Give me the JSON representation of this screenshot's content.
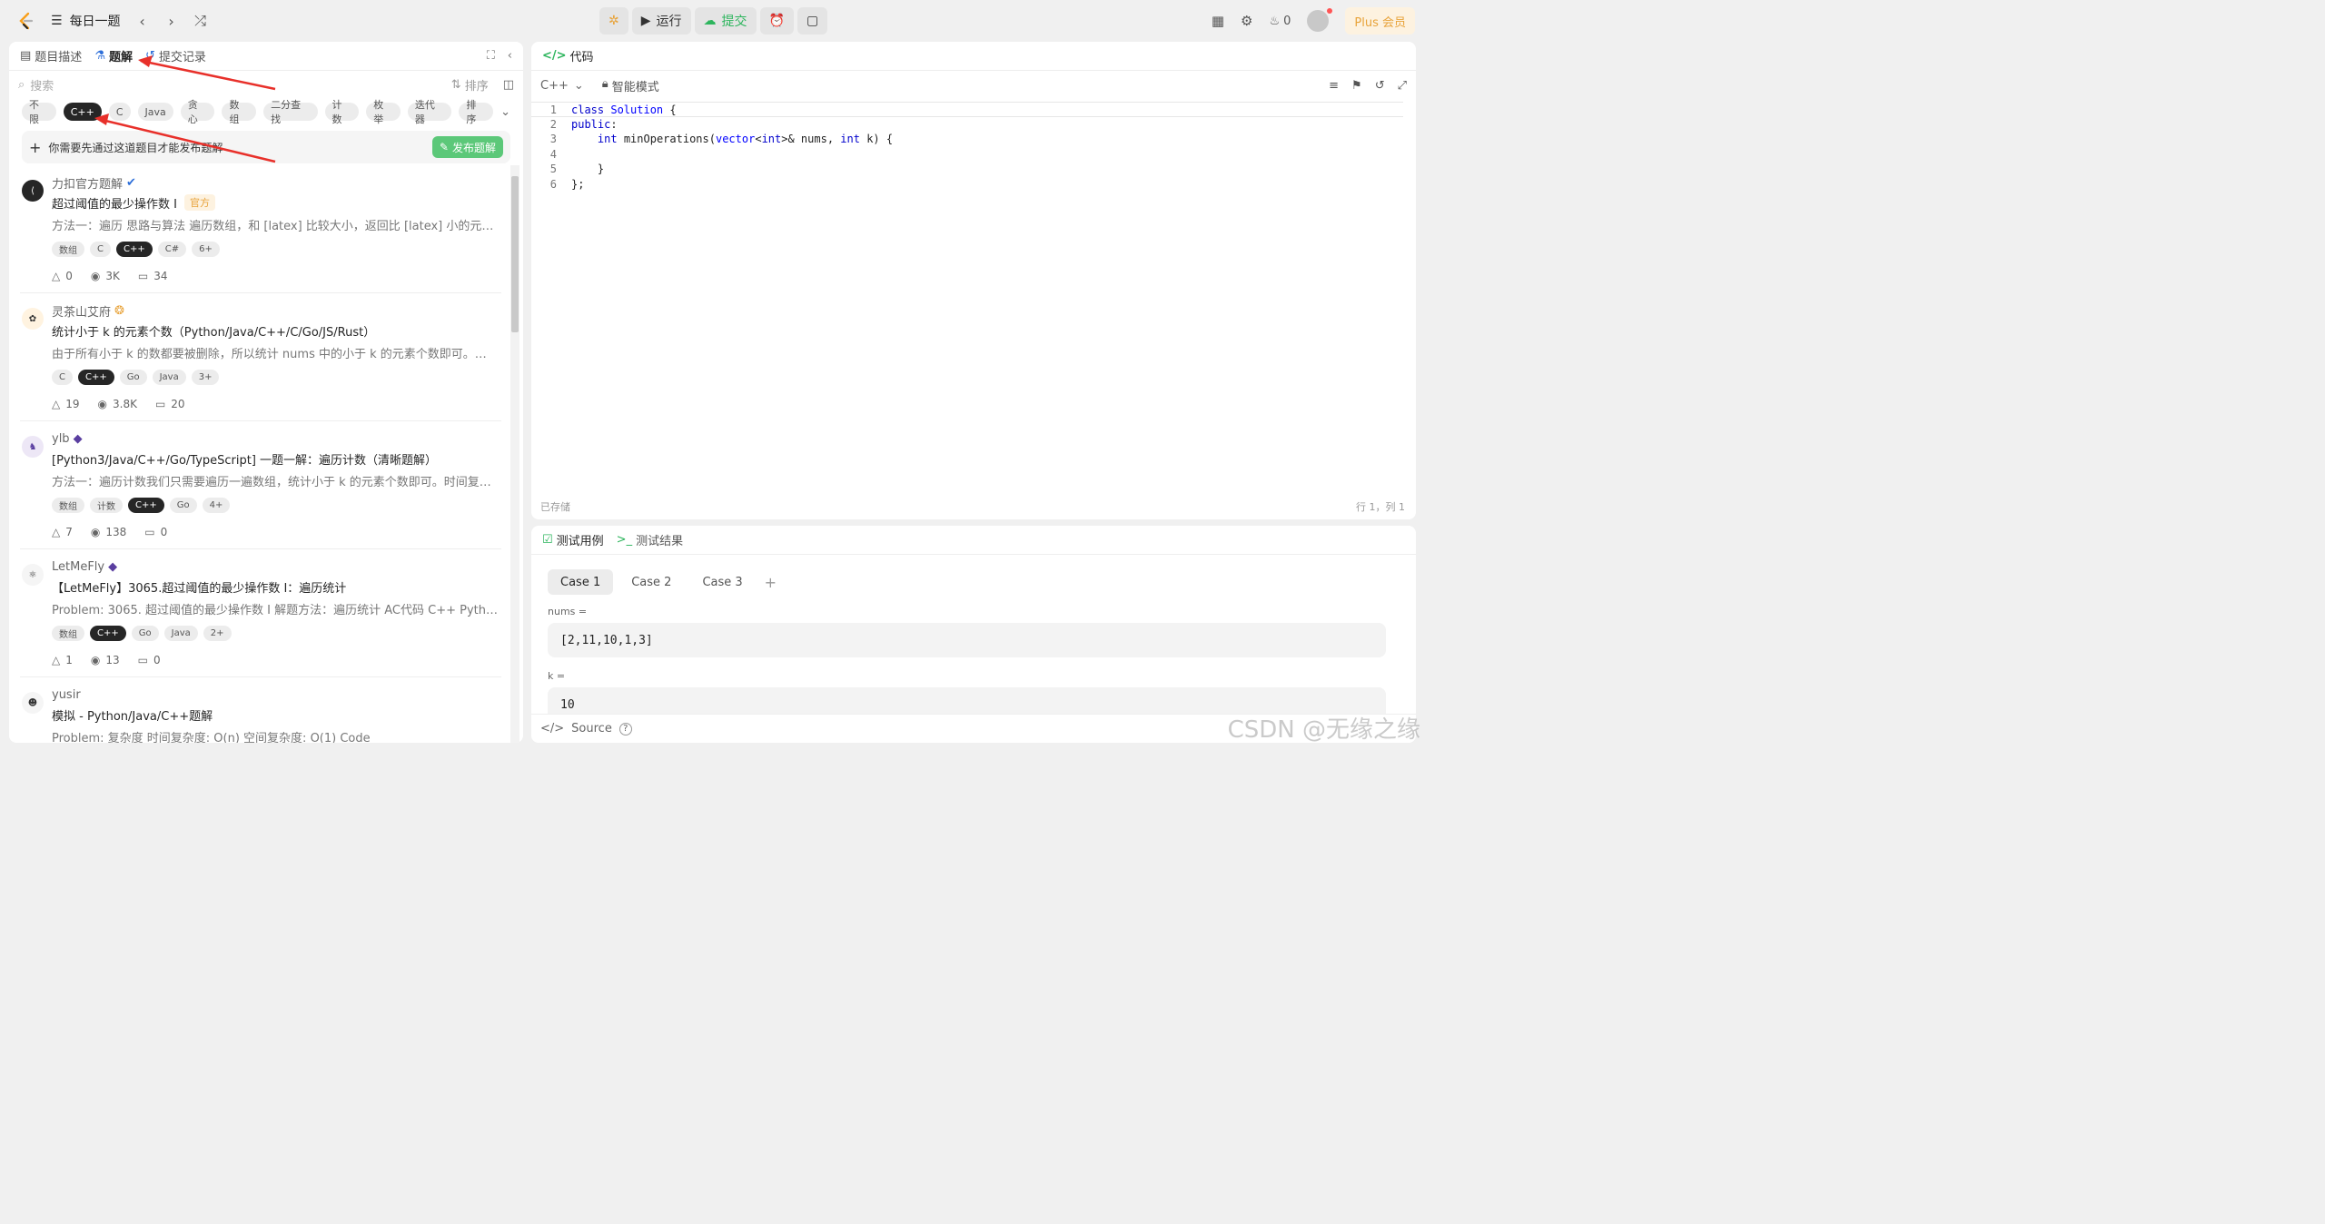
{
  "topbar": {
    "daily_label": "每日一题",
    "run_label": "运行",
    "submit_label": "提交",
    "fire_count": "0",
    "plus_label": "Plus 会员"
  },
  "left": {
    "tabs": [
      "题目描述",
      "题解",
      "提交记录"
    ],
    "search_placeholder": "搜索",
    "sort_label": "排序",
    "filter_tags": [
      "不限",
      "C++",
      "C",
      "Java",
      "贪心",
      "数组",
      "二分查找",
      "计数",
      "枚举",
      "迭代器",
      "排序"
    ],
    "notice": "你需要先通过这道题目才能发布题解",
    "publish_label": "发布题解",
    "solutions": [
      {
        "author": "力扣官方题解",
        "title": "超过阈值的最少操作数 I",
        "badge": "官方",
        "summary": "方法一：遍历 思路与算法 遍历数组，和 [latex] 比较大小，返回比 [latex] 小的元素的...",
        "tags": [
          "数组",
          "C",
          "C++",
          "C#",
          "6+"
        ],
        "likes": "0",
        "views": "3K",
        "comments": "34"
      },
      {
        "author": "灵茶山艾府",
        "title": "统计小于 k 的元素个数（Python/Java/C++/C/Go/JS/Rust）",
        "summary": "由于所有小于 k 的数都要被删除，所以统计 nums 中的小于 k 的元素个数即可。复杂...",
        "tags": [
          "C",
          "C++",
          "Go",
          "Java",
          "3+"
        ],
        "likes": "19",
        "views": "3.8K",
        "comments": "20"
      },
      {
        "author": "ylb",
        "title": "[Python3/Java/C++/Go/TypeScript] 一题一解：遍历计数（清晰题解）",
        "summary": "方法一：遍历计数我们只需要遍历一遍数组，统计小于 k 的元素个数即可。时间复杂...",
        "tags": [
          "数组",
          "计数",
          "C++",
          "Go",
          "4+"
        ],
        "likes": "7",
        "views": "138",
        "comments": "0"
      },
      {
        "author": "LetMeFly",
        "title": "【LetMeFly】3065.超过阈值的最少操作数 I：遍历统计",
        "summary": "Problem: 3065. 超过阈值的最少操作数 I 解题方法：遍历统计 AC代码 C++ Python Ja...",
        "tags": [
          "数组",
          "C++",
          "Go",
          "Java",
          "2+"
        ],
        "likes": "1",
        "views": "13",
        "comments": "0"
      },
      {
        "author": "yusir",
        "title": "模拟 - Python/Java/C++题解",
        "summary": "Problem: 复杂度 时间复杂度: O(n) 空间复杂度: O(1) Code",
        "tags": [],
        "likes": "",
        "views": "",
        "comments": ""
      }
    ]
  },
  "editor": {
    "title": "代码",
    "language": "C++",
    "mode": "智能模式",
    "saved": "已存储",
    "cursor": "行 1，列 1"
  },
  "tests": {
    "tab_cases": "测试用例",
    "tab_result": "测试结果",
    "cases": [
      "Case 1",
      "Case 2",
      "Case 3"
    ],
    "var1_label": "nums =",
    "var1_value": "[2,11,10,1,3]",
    "var2_label": "k =",
    "var2_value": "10",
    "source_label": "Source"
  },
  "watermark": "CSDN @无缘之缘",
  "colors": {
    "accent_green": "#2db55d",
    "plus_orange": "#e8a33a",
    "arrow_red": "#e8302a"
  }
}
